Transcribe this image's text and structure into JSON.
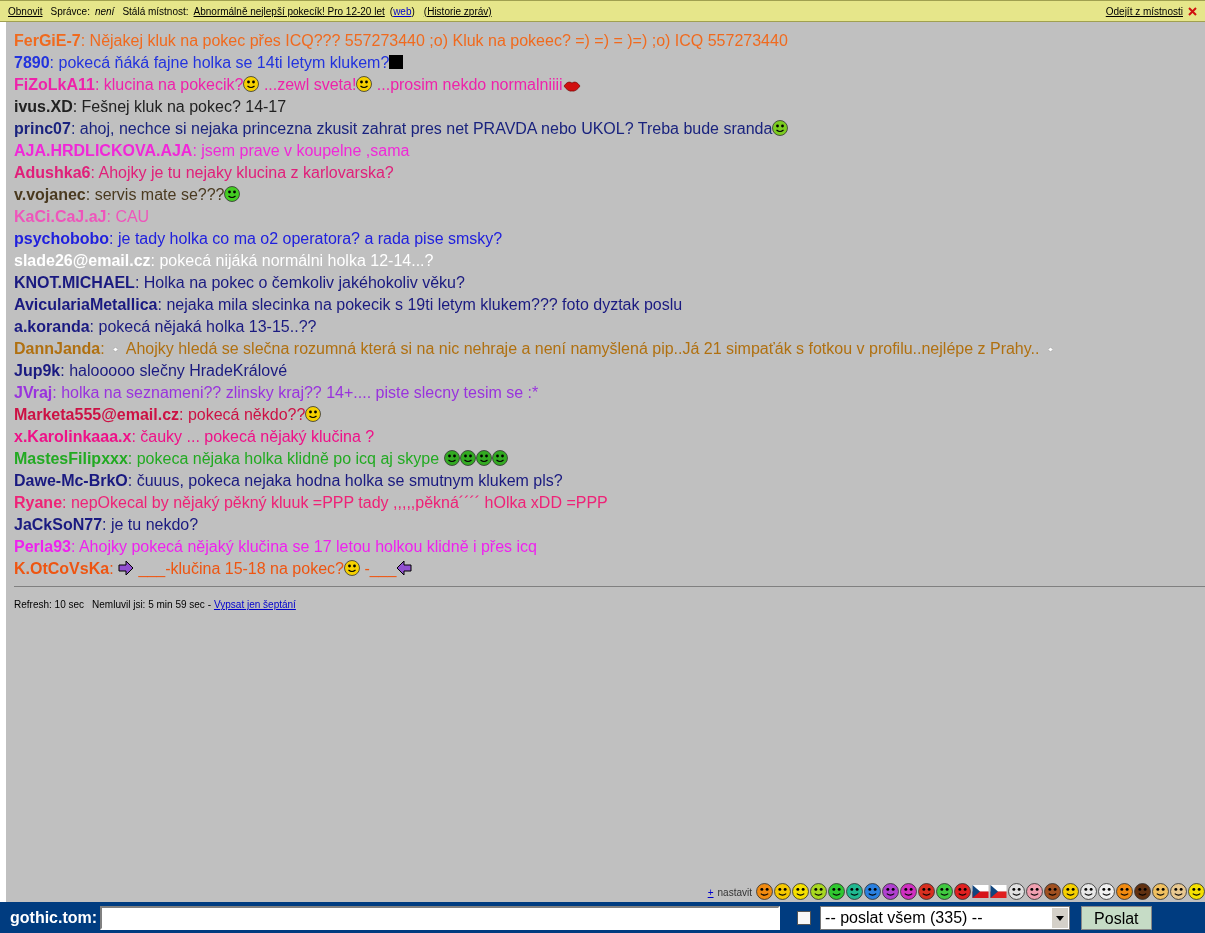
{
  "topbar": {
    "refresh": "Obnovit",
    "admin_label": "Správce:",
    "admin_value": "není",
    "room_label": "Stálá místnost:",
    "room_name": "Abnormálně nejlepší pokecík! Pro 12-20 let",
    "web_open": "(",
    "web_link": "web",
    "web_close": ")",
    "history": "(Historie zpráv)",
    "leave": "Odejít z místnosti"
  },
  "messages": [
    {
      "name": "FerGiE-7",
      "color": "#f06a1e",
      "parts": [
        {
          "kind": "text",
          "text": ": Nějakej kluk na pokec přes ICQ??? 557273440 ;o) Kluk na pokeec? =) =) = )=) ;o) ICQ 557273440"
        }
      ]
    },
    {
      "name": "7890",
      "color": "#2233dd",
      "parts": [
        {
          "kind": "text",
          "text": ": pokecá ňáká fajne holka se 14ti letym klukem?"
        },
        {
          "kind": "square"
        }
      ]
    },
    {
      "name": "FiZoLkA11",
      "color": "#ee22aa",
      "parts": [
        {
          "kind": "text",
          "text": ": klucina na pokecik?"
        },
        {
          "kind": "smiley",
          "color": "#f5d000"
        },
        {
          "kind": "text",
          "text": " ...zewl sveta!"
        },
        {
          "kind": "smiley",
          "color": "#f5d000"
        },
        {
          "kind": "text",
          "text": " ...prosim nekdo normalniiii"
        },
        {
          "kind": "lips"
        }
      ]
    },
    {
      "name": "ivus.XD",
      "color": "#222222",
      "parts": [
        {
          "kind": "text",
          "text": ": Fešnej kluk na pokec? 14-17"
        }
      ]
    },
    {
      "name": "princ07",
      "color": "#1a237e",
      "parts": [
        {
          "kind": "text",
          "text": ": ahoj, nechce si nejaka princezna zkusit zahrat pres net PRAVDA nebo UKOL? Treba bude sranda"
        },
        {
          "kind": "smiley",
          "color": "#7ccc20"
        }
      ]
    },
    {
      "name": "AJA.HRDLICKOVA.AJA",
      "color": "#f028d8",
      "parts": [
        {
          "kind": "text",
          "text": ": jsem prave v koupelne ,sama"
        }
      ]
    },
    {
      "name": "Adushka6",
      "color": "#e0207a",
      "parts": [
        {
          "kind": "text",
          "text": ": Ahojky je tu nejaky klucina z karlovarska?"
        }
      ]
    },
    {
      "name": "v.vojanec",
      "color": "#4a3a20",
      "parts": [
        {
          "kind": "text",
          "text": ": servis mate se???"
        },
        {
          "kind": "smiley",
          "color": "#44cc22"
        }
      ]
    },
    {
      "name": "KaCi.CaJ.aJ",
      "color": "#ee55bb",
      "parts": [
        {
          "kind": "text",
          "text": ": CAU"
        }
      ]
    },
    {
      "name": "psychobobo",
      "color": "#2020dd",
      "parts": [
        {
          "kind": "text",
          "text": ": je tady holka co ma o2 operatora? a rada pise smsky?"
        }
      ]
    },
    {
      "name": "slade26@email.cz",
      "color": "#ffffff",
      "parts": [
        {
          "kind": "text",
          "text": ": pokecá nijáká normálni holka 12-14...?"
        }
      ]
    },
    {
      "name": "KNOT.MICHAEL",
      "color": "#1a1a80",
      "parts": [
        {
          "kind": "text",
          "text": ": Holka na pokec o čemkoliv jakéhokoliv věku?"
        }
      ]
    },
    {
      "name": "AviculariaMetallica",
      "color": "#1a1a80",
      "parts": [
        {
          "kind": "text",
          "text": ": nejaka mila slecinka na pokecik s 19ti letym klukem??? foto dyztak poslu"
        }
      ]
    },
    {
      "name": "a.koranda",
      "color": "#1a1a80",
      "parts": [
        {
          "kind": "text",
          "text": ": pokecá nějaká holka 13-15..??"
        }
      ]
    },
    {
      "name": "DannJanda",
      "color": "#b07010",
      "parts": [
        {
          "kind": "text",
          "text": ": "
        },
        {
          "kind": "dot"
        },
        {
          "kind": "text",
          "text": " Ahojky hledá se slečna rozumná která si na nic nehraje a není namyšlená pip..Já 21 simpaťák s fotkou v profilu..nejlépe z Prahy.. "
        },
        {
          "kind": "dot"
        }
      ]
    },
    {
      "name": "Jup9k",
      "color": "#1a1a80",
      "parts": [
        {
          "kind": "text",
          "text": ": halooooo slečny HradeKrálové"
        }
      ]
    },
    {
      "name": "JVraj",
      "color": "#9933dd",
      "parts": [
        {
          "kind": "text",
          "text": ": holka na seznameni?? zlinsky kraj?? 14+.... piste slecny tesim se :*"
        }
      ]
    },
    {
      "name": "Marketa555@email.cz",
      "color": "#cc1144",
      "parts": [
        {
          "kind": "text",
          "text": ": pokecá někdo??"
        },
        {
          "kind": "smiley",
          "color": "#f5d000"
        }
      ]
    },
    {
      "name": "x.Karolinkaaa.x",
      "color": "#ee1188",
      "parts": [
        {
          "kind": "text",
          "text": ": čauky ... pokecá nějaký klučina ?"
        }
      ]
    },
    {
      "name": "MastesFilipxxx",
      "color": "#22aa22",
      "parts": [
        {
          "kind": "text",
          "text": ": pokeca nějaka holka klidně po icq aj skype "
        },
        {
          "kind": "smiley",
          "color": "#33aa22"
        },
        {
          "kind": "smiley",
          "color": "#33aa22"
        },
        {
          "kind": "smiley",
          "color": "#33aa22"
        },
        {
          "kind": "smiley",
          "color": "#33aa22"
        }
      ]
    },
    {
      "name": "Dawe-Mc-BrkO",
      "color": "#1a1a80",
      "parts": [
        {
          "kind": "text",
          "text": ": čuuus, pokeca nejaka hodna holka se smutnym klukem pls?"
        }
      ]
    },
    {
      "name": "Ryane",
      "color": "#ee2277",
      "parts": [
        {
          "kind": "text",
          "text": ": nepOkecal by nějaký pěkný kluuk =PPP tady ,,,,,pěkná´´´´ hOlka xDD =PPP"
        }
      ]
    },
    {
      "name": "JaCkSoN77",
      "color": "#1a1a80",
      "parts": [
        {
          "kind": "text",
          "text": ": je tu nekdo?"
        }
      ]
    },
    {
      "name": "Perla93",
      "color": "#ee22ee",
      "parts": [
        {
          "kind": "text",
          "text": ": Ahojky pokecá nějaký klučina se 17 letou holkou klidně i přes icq"
        }
      ]
    },
    {
      "name": "K.OtCoVsKa",
      "color": "#ee5511",
      "parts": [
        {
          "kind": "text",
          "text": ": "
        },
        {
          "kind": "arrowright"
        },
        {
          "kind": "text",
          "text": " ___-klučina 15-18 na pokec?"
        },
        {
          "kind": "smiley",
          "color": "#f5d000"
        },
        {
          "kind": "text",
          "text": " -___"
        },
        {
          "kind": "arrowleft"
        }
      ]
    }
  ],
  "status": {
    "refresh": "Refresh: 10 sec",
    "idle": "Nemluvil jsi: 5 min 59 sec -",
    "whisper_link": "Vypsat jen šeptání"
  },
  "emoticons": {
    "plus": "+",
    "settings": "nastavit",
    "items": [
      {
        "kind": "face",
        "color": "#f08a10"
      },
      {
        "kind": "face",
        "color": "#f5c800"
      },
      {
        "kind": "face",
        "color": "#f5e000"
      },
      {
        "kind": "face",
        "color": "#a8d820"
      },
      {
        "kind": "face",
        "color": "#30c830"
      },
      {
        "kind": "face",
        "color": "#20b890"
      },
      {
        "kind": "face",
        "color": "#2a80e0"
      },
      {
        "kind": "face",
        "color": "#b040d0"
      },
      {
        "kind": "face",
        "color": "#d030c0"
      },
      {
        "kind": "face",
        "color": "#d83020"
      },
      {
        "kind": "face",
        "color": "#40c840"
      },
      {
        "kind": "face",
        "color": "#e02020"
      },
      {
        "kind": "flag",
        "color": "#d7141a"
      },
      {
        "kind": "flag",
        "color": "#e02020"
      },
      {
        "kind": "face",
        "color": "#e0e0e0"
      },
      {
        "kind": "face",
        "color": "#f0a0b0"
      },
      {
        "kind": "face",
        "color": "#a05020"
      },
      {
        "kind": "face",
        "color": "#f5d000"
      },
      {
        "kind": "face",
        "color": "#e8e8e8"
      },
      {
        "kind": "face",
        "color": "#f0f0f0"
      },
      {
        "kind": "face",
        "color": "#f08a10"
      },
      {
        "kind": "face",
        "color": "#603010"
      },
      {
        "kind": "face",
        "color": "#f0c060"
      },
      {
        "kind": "face",
        "color": "#e8c890"
      },
      {
        "kind": "face",
        "color": "#f5e000"
      }
    ]
  },
  "composer": {
    "nick": "gothic.tom:",
    "private": false,
    "recipient": "-- poslat všem (335) --",
    "send": "Poslat"
  }
}
